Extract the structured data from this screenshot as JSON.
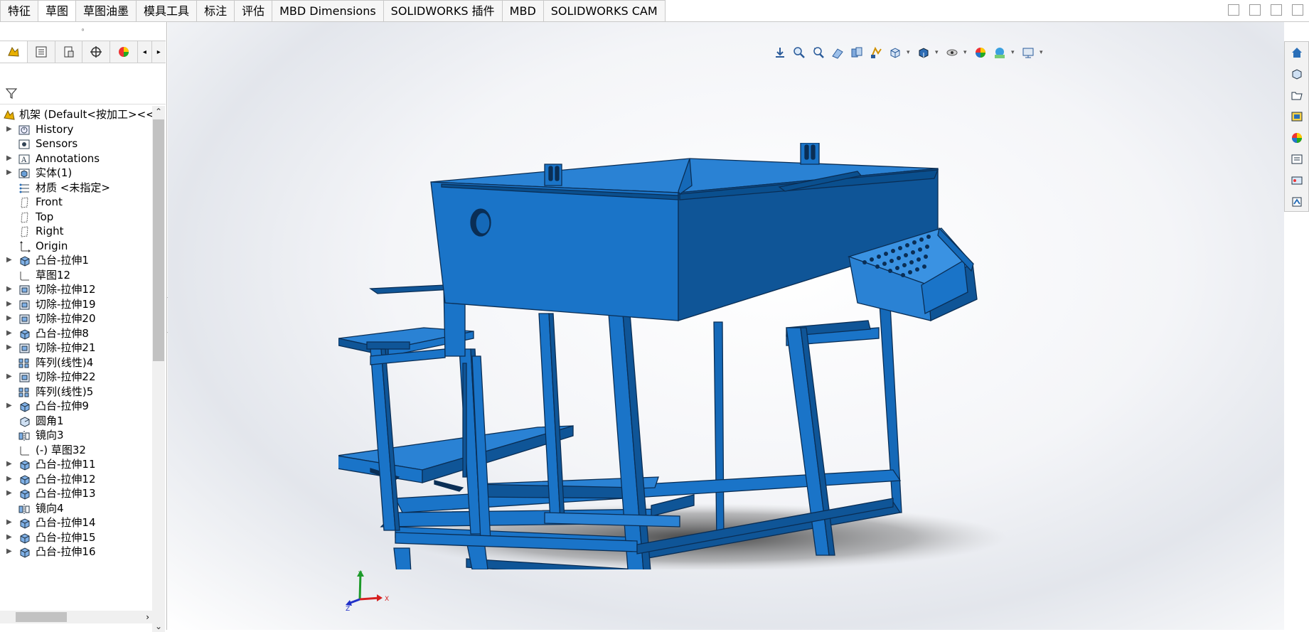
{
  "tabs": [
    {
      "label": "特征",
      "active": false
    },
    {
      "label": "草图",
      "active": true
    },
    {
      "label": "草图油墨",
      "active": false
    },
    {
      "label": "模具工具",
      "active": false
    },
    {
      "label": "标注",
      "active": false
    },
    {
      "label": "评估",
      "active": false
    },
    {
      "label": "MBD Dimensions",
      "active": false
    },
    {
      "label": "SOLIDWORKS 插件",
      "active": false
    },
    {
      "label": "MBD",
      "active": false
    },
    {
      "label": "SOLIDWORKS CAM",
      "active": false
    }
  ],
  "tree": {
    "root": "机架  (Default<按加工><<",
    "items": [
      {
        "label": "History",
        "icon": "history-icon",
        "expandable": true
      },
      {
        "label": "Sensors",
        "icon": "sensors-icon",
        "expandable": false
      },
      {
        "label": "Annotations",
        "icon": "annotations-icon",
        "expandable": true
      },
      {
        "label": "实体(1)",
        "icon": "solid-bodies-icon",
        "expandable": true
      },
      {
        "label": "材质 <未指定>",
        "icon": "material-icon",
        "expandable": false
      },
      {
        "label": "Front",
        "icon": "plane-icon",
        "expandable": false
      },
      {
        "label": "Top",
        "icon": "plane-icon",
        "expandable": false
      },
      {
        "label": "Right",
        "icon": "plane-icon",
        "expandable": false
      },
      {
        "label": "Origin",
        "icon": "origin-icon",
        "expandable": false
      },
      {
        "label": "凸台-拉伸1",
        "icon": "boss-extrude-icon",
        "expandable": true
      },
      {
        "label": "草图12",
        "icon": "sketch-icon",
        "expandable": false
      },
      {
        "label": "切除-拉伸12",
        "icon": "cut-extrude-icon",
        "expandable": true
      },
      {
        "label": "切除-拉伸19",
        "icon": "cut-extrude-icon",
        "expandable": true
      },
      {
        "label": "切除-拉伸20",
        "icon": "cut-extrude-icon",
        "expandable": true
      },
      {
        "label": "凸台-拉伸8",
        "icon": "boss-extrude-icon",
        "expandable": true
      },
      {
        "label": "切除-拉伸21",
        "icon": "cut-extrude-icon",
        "expandable": true
      },
      {
        "label": "阵列(线性)4",
        "icon": "linear-pattern-icon",
        "expandable": false
      },
      {
        "label": "切除-拉伸22",
        "icon": "cut-extrude-icon",
        "expandable": true
      },
      {
        "label": "阵列(线性)5",
        "icon": "linear-pattern-icon",
        "expandable": false
      },
      {
        "label": "凸台-拉伸9",
        "icon": "boss-extrude-icon",
        "expandable": true
      },
      {
        "label": "圆角1",
        "icon": "fillet-icon",
        "expandable": false
      },
      {
        "label": "镜向3",
        "icon": "mirror-icon",
        "expandable": false
      },
      {
        "label": "(-) 草图32",
        "icon": "sketch-icon",
        "expandable": false
      },
      {
        "label": "凸台-拉伸11",
        "icon": "boss-extrude-icon",
        "expandable": true
      },
      {
        "label": "凸台-拉伸12",
        "icon": "boss-extrude-icon",
        "expandable": true
      },
      {
        "label": "凸台-拉伸13",
        "icon": "boss-extrude-icon",
        "expandable": true
      },
      {
        "label": "镜向4",
        "icon": "mirror-icon",
        "expandable": false
      },
      {
        "label": "凸台-拉伸14",
        "icon": "boss-extrude-icon",
        "expandable": true
      },
      {
        "label": "凸台-拉伸15",
        "icon": "boss-extrude-icon",
        "expandable": true
      },
      {
        "label": "凸台-拉伸16",
        "icon": "boss-extrude-icon",
        "expandable": true
      }
    ]
  },
  "triad": {
    "x": "X",
    "y": "Y",
    "z": "Z"
  },
  "colors": {
    "model": "#1a74c8",
    "model_dark": "#0f5597",
    "model_light": "#3a92e2",
    "x_axis": "#d62020",
    "y_axis": "#1d9a2a",
    "z_axis": "#2030c8"
  }
}
